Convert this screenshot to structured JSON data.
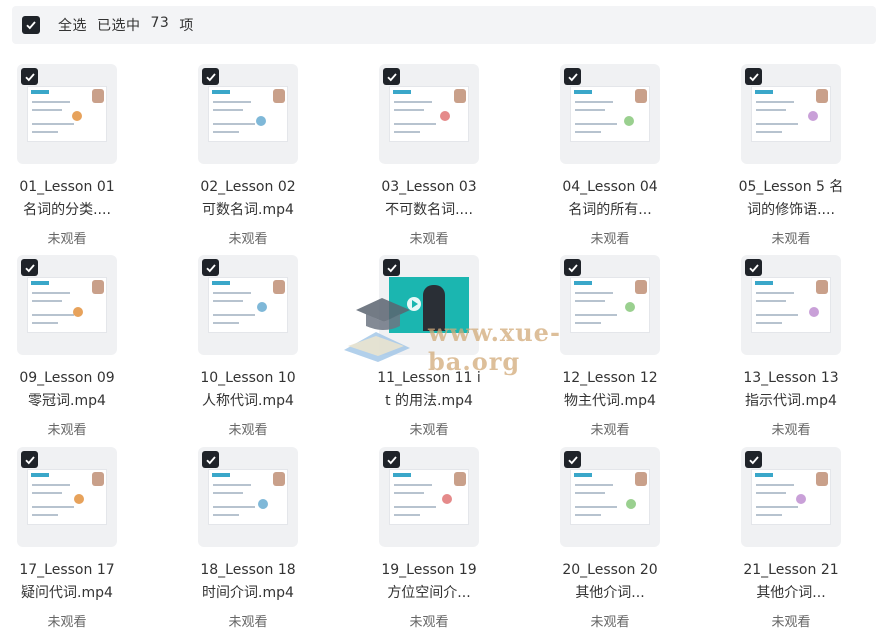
{
  "select_bar": {
    "select_all": "全选",
    "selected_prefix": "已选中",
    "selected_count": "73",
    "selected_suffix": "项"
  },
  "watermark": "www.xue-ba.org",
  "items": [
    {
      "line1": "01_Lesson 01",
      "line2": "名词的分类....",
      "status": "未观看"
    },
    {
      "line1": "02_Lesson 02",
      "line2": "可数名词.mp4",
      "status": "未观看"
    },
    {
      "line1": "03_Lesson 03",
      "line2": "不可数名词....",
      "status": "未观看"
    },
    {
      "line1": "04_Lesson 04",
      "line2": "名词的所有...",
      "status": "未观看"
    },
    {
      "line1": "05_Lesson 5 名",
      "line2": "词的修饰语....",
      "status": "未观看"
    },
    {
      "line1": "09_Lesson 09",
      "line2": "零冠词.mp4",
      "status": "未观看"
    },
    {
      "line1": "10_Lesson 10",
      "line2": "人称代词.mp4",
      "status": "未观看"
    },
    {
      "line1": "11_Lesson 11 i",
      "line2": "t 的用法.mp4",
      "status": "未观看"
    },
    {
      "line1": "12_Lesson 12",
      "line2": "物主代词.mp4",
      "status": "未观看"
    },
    {
      "line1": "13_Lesson 13",
      "line2": "指示代词.mp4",
      "status": "未观看"
    },
    {
      "line1": "17_Lesson 17",
      "line2": "疑问代词.mp4",
      "status": "未观看"
    },
    {
      "line1": "18_Lesson 18",
      "line2": "时间介词.mp4",
      "status": "未观看"
    },
    {
      "line1": "19_Lesson 19",
      "line2": "方位空间介...",
      "status": "未观看"
    },
    {
      "line1": "20_Lesson 20",
      "line2": "其他介词...",
      "status": "未观看"
    },
    {
      "line1": "21_Lesson 21",
      "line2": "其他介词...",
      "status": "未观看"
    }
  ]
}
